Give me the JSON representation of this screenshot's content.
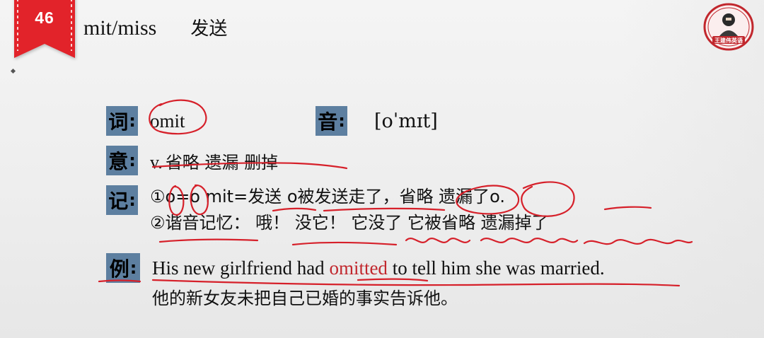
{
  "slide": {
    "number": "46",
    "root": "mit/miss",
    "root_meaning": "发送"
  },
  "seal": {
    "text": "王建伟英语"
  },
  "rows": {
    "word": {
      "label": "词",
      "colon": ":",
      "value": "omit"
    },
    "sound": {
      "label": "音",
      "colon": ":",
      "value": "[oˈmɪt]"
    },
    "meaning": {
      "label": "意",
      "colon": ":",
      "pos": "v.",
      "value": "省略  遗漏  删掉"
    },
    "memo": {
      "label": "记",
      "colon": ":",
      "line1": "①o=o  mit=发送  o被发送走了，省略 遗漏了o.",
      "line2": "②谐音记忆： 哦！ 没它！ 它没了  它被省略  遗漏掉了"
    },
    "example": {
      "label": "例",
      "colon": ":",
      "en_before": "His new girlfriend had ",
      "en_highlight": "omitted",
      "en_after": " to tell him she was married.",
      "cn": "他的新女友未把自己已婚的事实告诉他。"
    }
  },
  "colors": {
    "ribbon_red": "#e2232a",
    "label_bg": "#5d7fa0",
    "highlight_red": "#c1272d",
    "ink_red": "#d6202a"
  }
}
